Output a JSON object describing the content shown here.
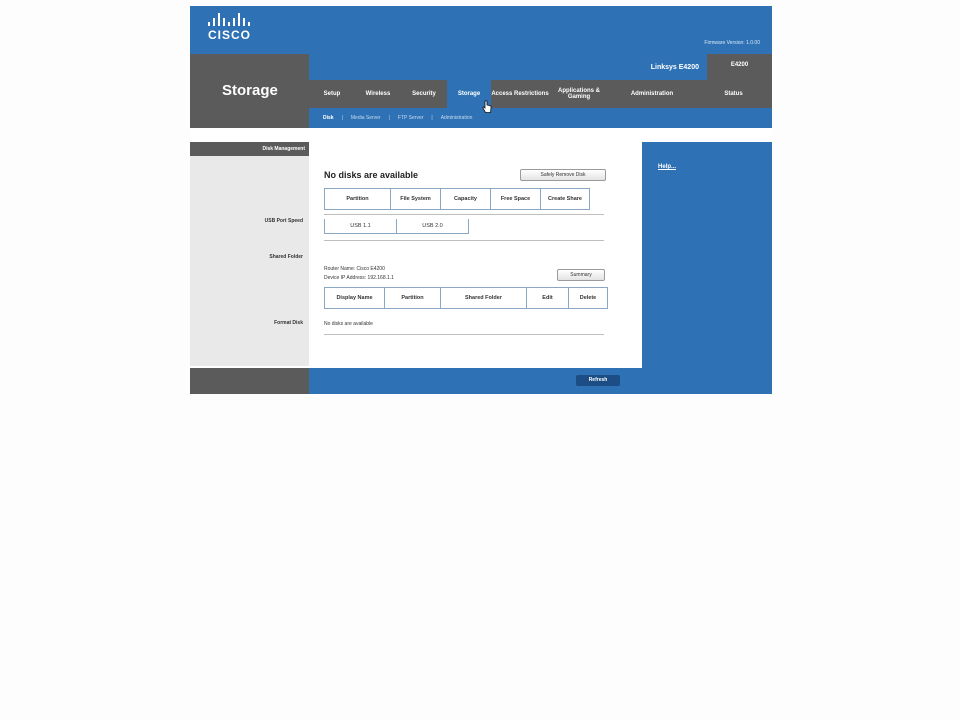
{
  "logo": {
    "text": "CISCO"
  },
  "firmware": "Firmware Version: 1.0.00",
  "page_title": "Storage",
  "model": {
    "name": "Linksys E4200",
    "number": "E4200"
  },
  "tabs": [
    {
      "label": "Setup"
    },
    {
      "label": "Wireless"
    },
    {
      "label": "Security"
    },
    {
      "label": "Storage"
    },
    {
      "label": "Access Restrictions"
    },
    {
      "label": "Applications & Gaming"
    },
    {
      "label": "Administration"
    },
    {
      "label": "Status"
    }
  ],
  "subnav": [
    "Disk",
    "Media Server",
    "FTP Server",
    "Administration"
  ],
  "sidebar": {
    "head": "Disk Management",
    "usb_port_speed": "USB Port Speed",
    "shared_folder": "Shared Folder",
    "format_disk": "Format Disk"
  },
  "main": {
    "no_disks": "No disks are available",
    "safely_remove_button": "Safely Remove Disk",
    "disk_table_headers": [
      "Partition",
      "File System",
      "Capacity",
      "Free Space",
      "Create Share"
    ],
    "usb_speed_headers": [
      "USB 1.1",
      "USB 2.0"
    ],
    "router_name": "Router Name: Cisco E4200",
    "ip_address": "Device IP Address: 192.168.1.1",
    "summary_button": "Summary",
    "share_table_headers": [
      "Display Name",
      "Partition",
      "Shared Folder",
      "Edit",
      "Delete"
    ],
    "no_disks_small": "No disks are available"
  },
  "help": {
    "label": "Help..."
  },
  "refresh_button": "Refresh",
  "colors": {
    "brand_blue": "#2e72b5",
    "dark_gray": "#5b5b5b"
  }
}
